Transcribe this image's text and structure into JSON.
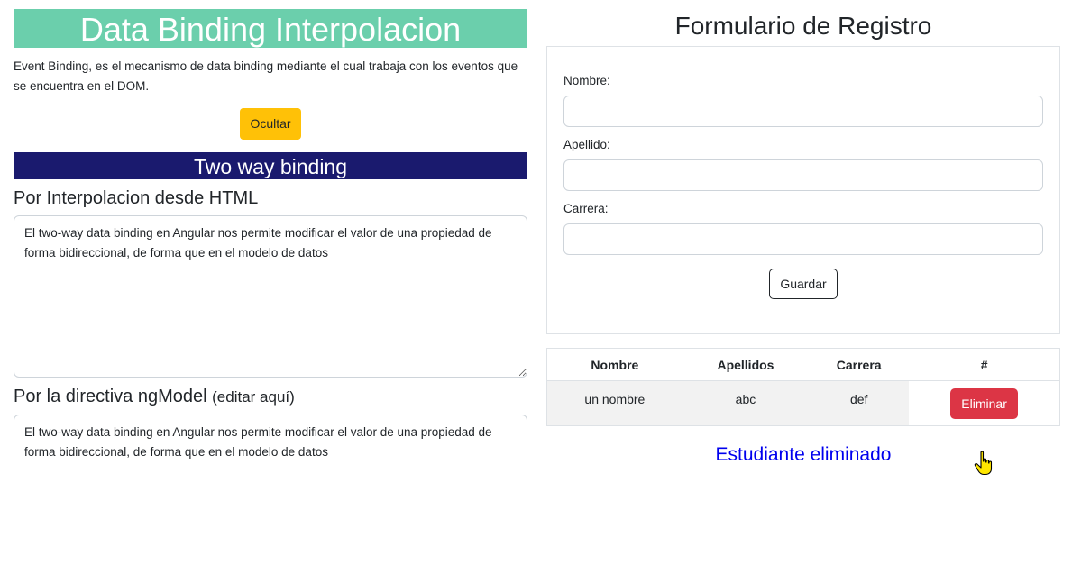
{
  "left": {
    "title": "Data Binding Interpolacion",
    "intro": "Event Binding, es el mecanismo de data binding mediante el cual trabaja con los eventos que se encuentra en el DOM.",
    "hide_button": "Ocultar",
    "two_way_title": "Two way binding",
    "interp_heading": "Por Interpolacion desde HTML",
    "interp_text": "El two-way data binding en Angular nos permite modificar el valor de una propiedad de forma bidireccional, de forma que en el modelo de datos",
    "ngmodel_heading": "Por la directiva ngModel",
    "ngmodel_hint": "(editar aquí)",
    "ngmodel_text": "El two-way data binding en Angular nos permite modificar el valor de una propiedad de forma bidireccional, de forma que en el modelo de datos"
  },
  "form": {
    "title": "Formulario de Registro",
    "nombre_label": "Nombre:",
    "nombre_value": "",
    "apellido_label": "Apellido:",
    "apellido_value": "",
    "carrera_label": "Carrera:",
    "carrera_value": "",
    "save_button": "Guardar"
  },
  "table": {
    "headers": [
      "Nombre",
      "Apellidos",
      "Carrera",
      "#"
    ],
    "rows": [
      {
        "nombre": "un nombre",
        "apellidos": "abc",
        "carrera": "def",
        "action": "Eliminar"
      }
    ]
  },
  "status_message": "Estudiante eliminado",
  "colors": {
    "green_banner": "#6bcfac",
    "navy_banner": "#1a1a6e",
    "warning": "#ffc107",
    "danger": "#dc3545",
    "message": "#0000ee"
  },
  "cursor_icon": "hand-pointer-icon"
}
